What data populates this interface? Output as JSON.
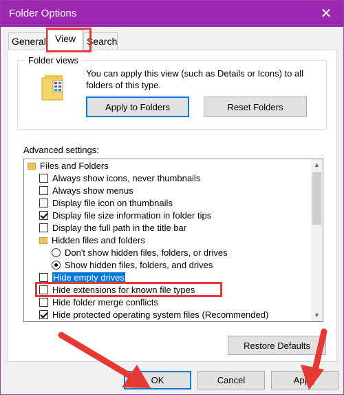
{
  "window": {
    "title": "Folder Options",
    "close_label": "✕"
  },
  "tabs": [
    {
      "label": "General",
      "active": false
    },
    {
      "label": "View",
      "active": true
    },
    {
      "label": "Search",
      "active": false
    }
  ],
  "folder_views": {
    "title": "Folder views",
    "description": "You can apply this view (such as Details or Icons) to all folders of this type.",
    "apply_button": "Apply to Folders",
    "reset_button": "Reset Folders"
  },
  "advanced": {
    "label": "Advanced settings:",
    "items": [
      {
        "type": "folder",
        "label": "Files and Folders"
      },
      {
        "type": "checkbox",
        "label": "Always show icons, never thumbnails",
        "checked": false
      },
      {
        "type": "checkbox",
        "label": "Always show menus",
        "checked": false
      },
      {
        "type": "checkbox",
        "label": "Display file icon on thumbnails",
        "checked": false
      },
      {
        "type": "checkbox",
        "label": "Display file size information in folder tips",
        "checked": true
      },
      {
        "type": "checkbox",
        "label": "Display the full path in the title bar",
        "checked": false
      },
      {
        "type": "folder",
        "label": "Hidden files and folders"
      },
      {
        "type": "radio",
        "label": "Don't show hidden files, folders, or drives",
        "checked": false
      },
      {
        "type": "radio",
        "label": "Show hidden files, folders, and drives",
        "checked": true
      },
      {
        "type": "checkbox",
        "label": "Hide empty drives",
        "checked": false,
        "selected": true
      },
      {
        "type": "checkbox",
        "label": "Hide extensions for known file types",
        "checked": false
      },
      {
        "type": "checkbox",
        "label": "Hide folder merge conflicts",
        "checked": false
      },
      {
        "type": "checkbox",
        "label": "Hide protected operating system files (Recommended)",
        "checked": true
      }
    ]
  },
  "restore_button": "Restore Defaults",
  "footer": {
    "ok": "OK",
    "cancel": "Cancel",
    "apply": "Apply"
  },
  "colors": {
    "titlebar": "#9c27b0",
    "highlight": "#0078d7",
    "annotation": "#e53935"
  }
}
